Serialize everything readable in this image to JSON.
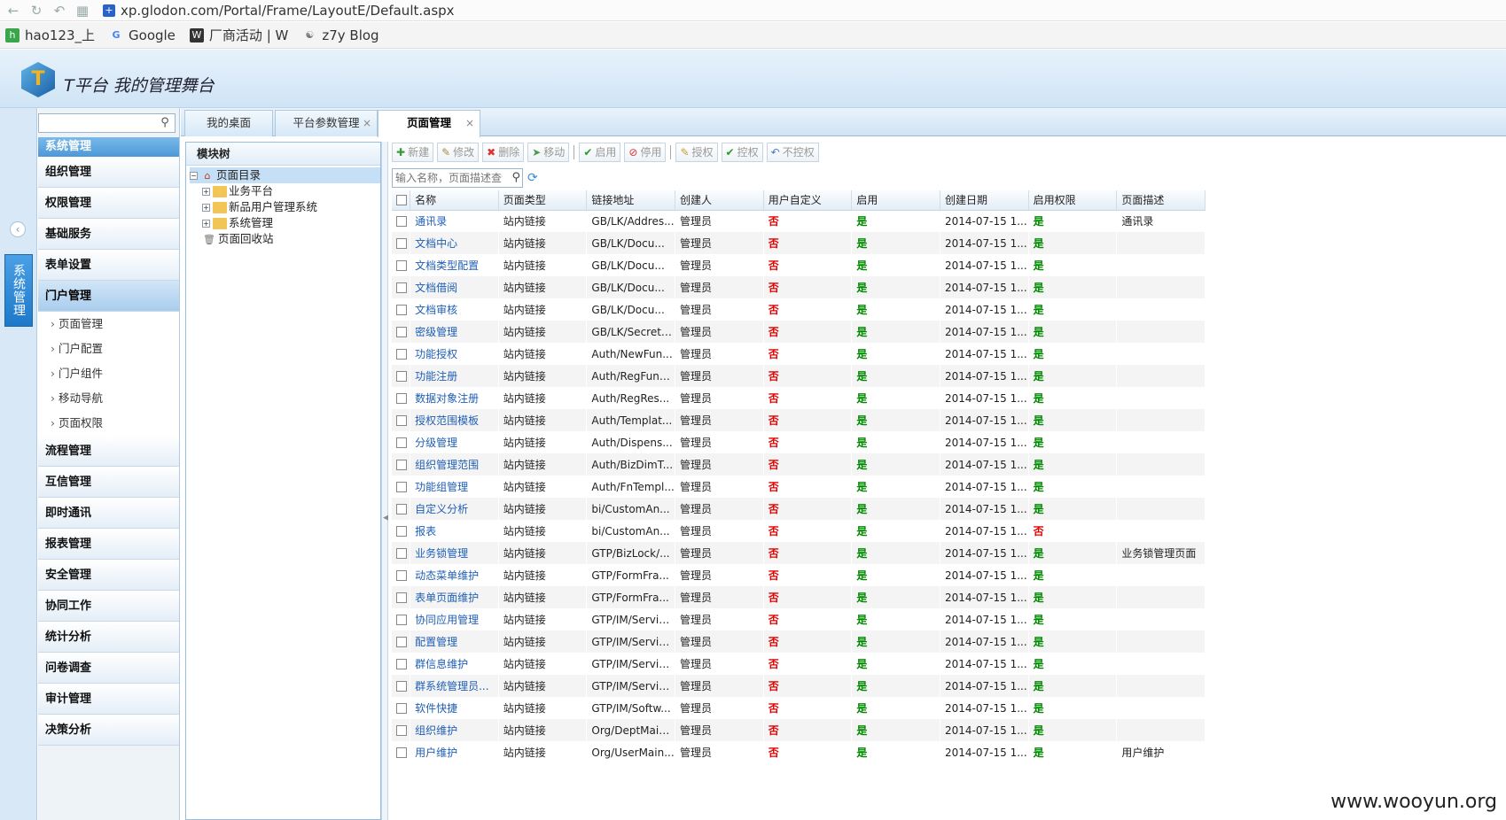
{
  "browser": {
    "url": "xp.glodon.com/Portal/Frame/LayoutE/Default.aspx",
    "bookmarks": [
      {
        "label": "hao123_上",
        "icon": "hao123-icon"
      },
      {
        "label": "Google",
        "icon": "google-icon"
      },
      {
        "label": "厂商活动 | W",
        "icon": "wooyun-icon"
      },
      {
        "label": "z7y Blog",
        "icon": "blog-icon"
      }
    ]
  },
  "app": {
    "title": "T平台  我的管理舞台"
  },
  "vertical_tab": {
    "label": "系统管理"
  },
  "menu": {
    "search_placeholder": "",
    "header": "系统管理",
    "items_top": [
      "组织管理",
      "权限管理",
      "基础服务",
      "表单设置"
    ],
    "active_item": "门户管理",
    "sub_items": [
      "页面管理",
      "门户配置",
      "门户组件",
      "移动导航",
      "页面权限"
    ],
    "items_bottom": [
      "流程管理",
      "互信管理",
      "即时通讯",
      "报表管理",
      "安全管理",
      "协同工作",
      "统计分析",
      "问卷调查",
      "审计管理",
      "决策分析"
    ]
  },
  "tabs": [
    {
      "label": "我的桌面",
      "closable": false
    },
    {
      "label": "平台参数管理",
      "closable": true
    },
    {
      "label": "页面管理",
      "closable": true,
      "active": true
    }
  ],
  "tree": {
    "header": "模块树",
    "root": "页面目录",
    "children": [
      "业务平台",
      "新品用户管理系统",
      "系统管理"
    ],
    "recycle": "页面回收站"
  },
  "toolbar": {
    "buttons": [
      "新建",
      "修改",
      "删除",
      "移动",
      "启用",
      "停用",
      "授权",
      "控权",
      "不控权"
    ],
    "search_placeholder": "输入名称，页面描述查询"
  },
  "grid": {
    "columns": [
      "名称",
      "页面类型",
      "链接地址",
      "创建人",
      "用户自定义",
      "启用",
      "创建日期",
      "启用权限",
      "页面描述"
    ],
    "rows": [
      [
        "通讯录",
        "站内链接",
        "GB/LK/Addres...",
        "管理员",
        "否",
        "是",
        "2014-07-15 1...",
        "是",
        "通讯录"
      ],
      [
        "文档中心",
        "站内链接",
        "GB/LK/Docu...",
        "管理员",
        "否",
        "是",
        "2014-07-15 1...",
        "是",
        ""
      ],
      [
        "文档类型配置",
        "站内链接",
        "GB/LK/Docu...",
        "管理员",
        "否",
        "是",
        "2014-07-15 1...",
        "是",
        ""
      ],
      [
        "文档借阅",
        "站内链接",
        "GB/LK/Docu...",
        "管理员",
        "否",
        "是",
        "2014-07-15 1...",
        "是",
        ""
      ],
      [
        "文档审核",
        "站内链接",
        "GB/LK/Docu...",
        "管理员",
        "否",
        "是",
        "2014-07-15 1...",
        "是",
        ""
      ],
      [
        "密级管理",
        "站内链接",
        "GB/LK/Secret/...",
        "管理员",
        "否",
        "是",
        "2014-07-15 1...",
        "是",
        ""
      ],
      [
        "功能授权",
        "站内链接",
        "Auth/NewFun...",
        "管理员",
        "否",
        "是",
        "2014-07-15 1...",
        "是",
        ""
      ],
      [
        "功能注册",
        "站内链接",
        "Auth/RegFunc...",
        "管理员",
        "否",
        "是",
        "2014-07-15 1...",
        "是",
        ""
      ],
      [
        "数据对象注册",
        "站内链接",
        "Auth/RegRes...",
        "管理员",
        "否",
        "是",
        "2014-07-15 1...",
        "是",
        ""
      ],
      [
        "授权范围模板",
        "站内链接",
        "Auth/Templat...",
        "管理员",
        "否",
        "是",
        "2014-07-15 1...",
        "是",
        ""
      ],
      [
        "分级管理",
        "站内链接",
        "Auth/Dispens...",
        "管理员",
        "否",
        "是",
        "2014-07-15 1...",
        "是",
        ""
      ],
      [
        "组织管理范围",
        "站内链接",
        "Auth/BizDimT...",
        "管理员",
        "否",
        "是",
        "2014-07-15 1...",
        "是",
        ""
      ],
      [
        "功能组管理",
        "站内链接",
        "Auth/FnTempl...",
        "管理员",
        "否",
        "是",
        "2014-07-15 1...",
        "是",
        ""
      ],
      [
        "自定义分析",
        "站内链接",
        "bi/CustomAn...",
        "管理员",
        "否",
        "是",
        "2014-07-15 1...",
        "是",
        ""
      ],
      [
        "报表",
        "站内链接",
        "bi/CustomAn...",
        "管理员",
        "否",
        "是",
        "2014-07-15 1...",
        "否",
        ""
      ],
      [
        "业务锁管理",
        "站内链接",
        "GTP/BizLock/...",
        "管理员",
        "否",
        "是",
        "2014-07-15 1...",
        "是",
        "业务锁管理页面"
      ],
      [
        "动态菜单维护",
        "站内链接",
        "GTP/FormFra...",
        "管理员",
        "否",
        "是",
        "2014-07-15 1...",
        "是",
        ""
      ],
      [
        "表单页面维护",
        "站内链接",
        "GTP/FormFra...",
        "管理员",
        "否",
        "是",
        "2014-07-15 1...",
        "是",
        ""
      ],
      [
        "协同应用管理",
        "站内链接",
        "GTP/IM/Servic...",
        "管理员",
        "否",
        "是",
        "2014-07-15 1...",
        "是",
        ""
      ],
      [
        "配置管理",
        "站内链接",
        "GTP/IM/Servic...",
        "管理员",
        "否",
        "是",
        "2014-07-15 1...",
        "是",
        ""
      ],
      [
        "群信息维护",
        "站内链接",
        "GTP/IM/Servic...",
        "管理员",
        "否",
        "是",
        "2014-07-15 1...",
        "是",
        ""
      ],
      [
        "群系统管理员...",
        "站内链接",
        "GTP/IM/Servic...",
        "管理员",
        "否",
        "是",
        "2014-07-15 1...",
        "是",
        ""
      ],
      [
        "软件快捷",
        "站内链接",
        "GTP/IM/Softw...",
        "管理员",
        "否",
        "是",
        "2014-07-15 1...",
        "是",
        ""
      ],
      [
        "组织维护",
        "站内链接",
        "Org/DeptMain...",
        "管理员",
        "否",
        "是",
        "2014-07-15 1...",
        "是",
        ""
      ],
      [
        "用户维护",
        "站内链接",
        "Org/UserMain...",
        "管理员",
        "否",
        "是",
        "2014-07-15 1...",
        "是",
        "用户维护"
      ]
    ]
  },
  "watermark": "www.wooyun.org"
}
